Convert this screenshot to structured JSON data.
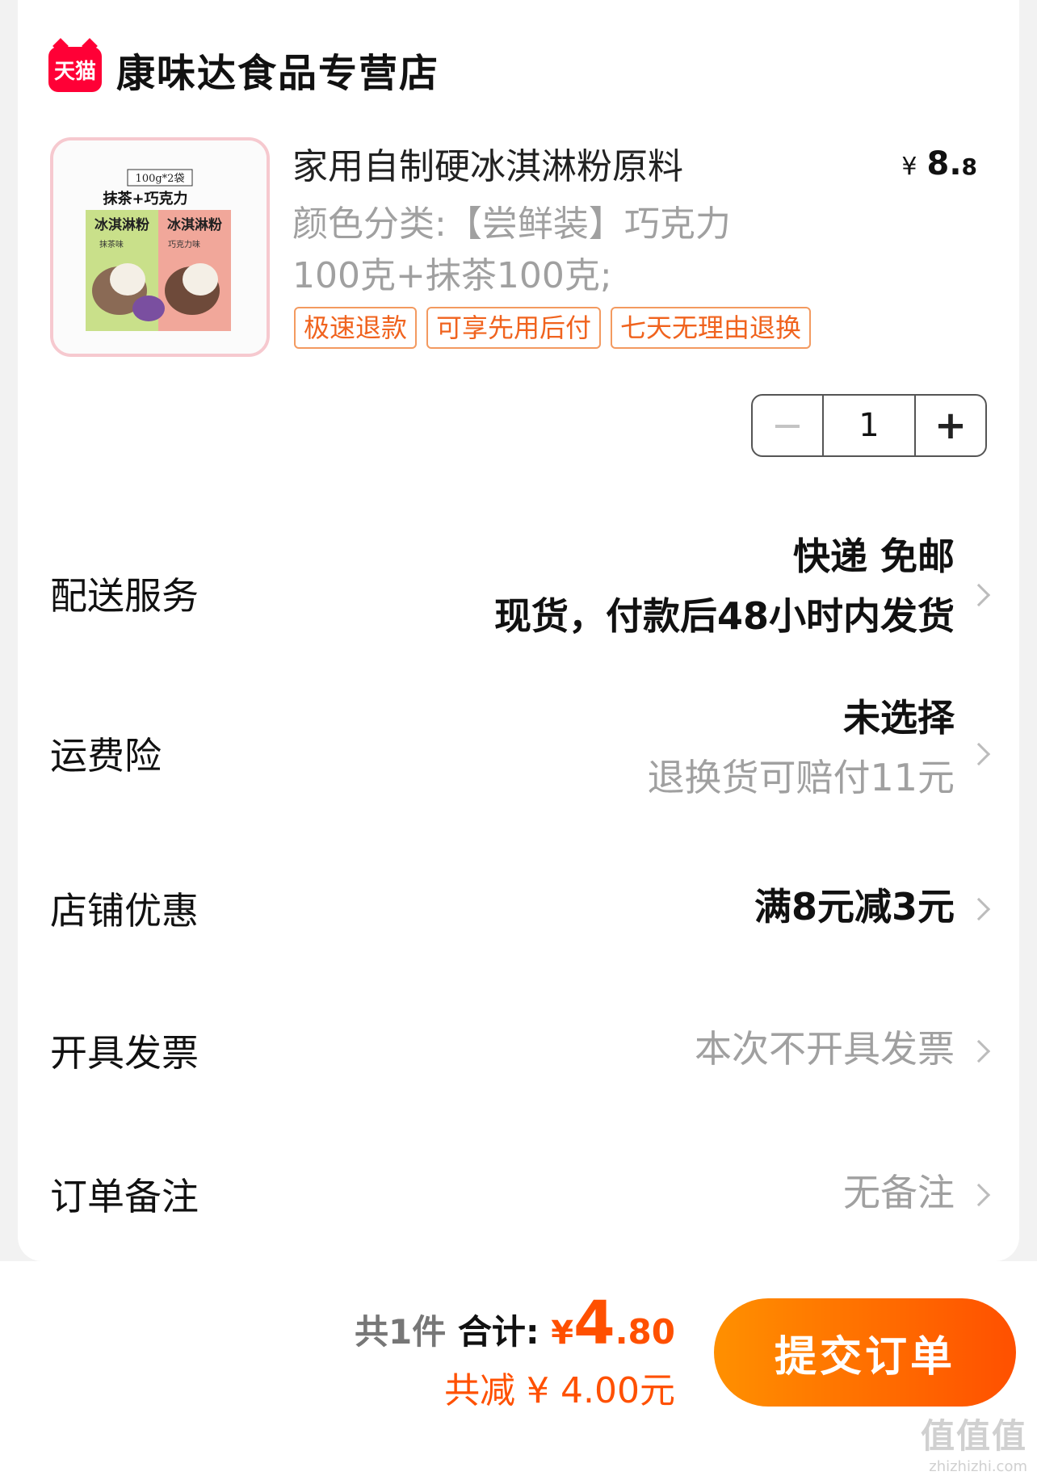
{
  "shop": {
    "badge": "天猫",
    "name": "康味达食品专营店"
  },
  "product": {
    "title": "家用自制硬冰淇淋粉原料",
    "price_symbol": "¥",
    "price_int": "8.",
    "price_dec": "8",
    "variant_line1": "颜色分类:【尝鲜装】巧克力",
    "variant_line2": "100克+抹茶100克;",
    "tags": [
      "极速退款",
      "可享先用后付",
      "七天无理由退换"
    ],
    "image": {
      "pack_label": "100g*2袋",
      "flavors_title": "抹茶+巧克力",
      "left_bag_title": "冰淇淋粉",
      "left_bag_flavor": "抹茶味",
      "right_bag_title": "冰淇淋粉",
      "right_bag_flavor": "巧克力味",
      "colors": {
        "matcha": "#c9e08a",
        "chocolate": "#f1a79a"
      }
    }
  },
  "stepper": {
    "minus": "−",
    "quantity": "1",
    "plus": "+"
  },
  "rows": {
    "delivery": {
      "label": "配送服务",
      "line1": "快递 免邮",
      "line2": "现货，付款后48小时内发货"
    },
    "insurance": {
      "label": "运费险",
      "line1": "未选择",
      "line2": "退换货可赔付11元"
    },
    "discount": {
      "label": "店铺优惠",
      "value": "满8元减3元"
    },
    "invoice": {
      "label": "开具发票",
      "value": "本次不开具发票"
    },
    "note": {
      "label": "订单备注",
      "value": "无备注"
    }
  },
  "summary": {
    "count": "共1件",
    "total_label": "合计:",
    "yen": "¥",
    "total_int": "4",
    "total_dec": ".80",
    "savings": "共减 ¥ 4.00元"
  },
  "submit_label": "提交订单",
  "watermark": {
    "main": "值值值",
    "sub": "zhizhizhi.com"
  },
  "colors": {
    "accent": "#ff5000",
    "tag_border": "#f39a60",
    "tmall_red": "#ff0036"
  }
}
